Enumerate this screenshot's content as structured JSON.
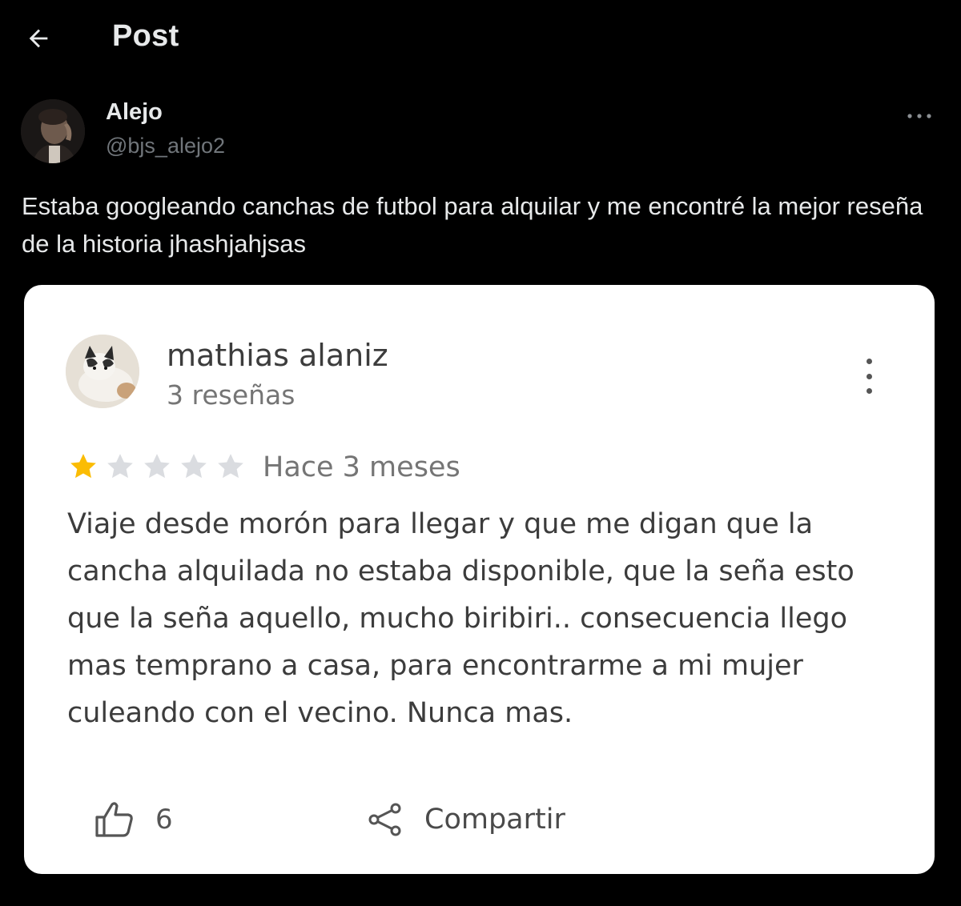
{
  "header": {
    "title": "Post"
  },
  "post": {
    "author_name": "Alejo",
    "author_handle": "@bjs_alejo2",
    "text": "Estaba googleando canchas de futbol para alquilar y me encontré la mejor reseña de la historia jhashjahjsas"
  },
  "review": {
    "reviewer_name": "mathias alaniz",
    "reviewer_count": "3 reseñas",
    "rating": 1,
    "rating_max": 5,
    "date": "Hace 3 meses",
    "text": "Viaje desde morón para llegar y que me digan que la cancha alquilada no estaba disponible, que la seña esto que la seña aquello, mucho biribiri.. consecuencia llego mas temprano a casa, para encontrarme a mi mujer culeando con el vecino. Nunca mas.",
    "likes": "6",
    "share_label": "Compartir"
  },
  "colors": {
    "background": "#000000",
    "card": "#ffffff",
    "star_filled": "#fbbc04",
    "star_empty": "#dadce0"
  },
  "icons": {
    "back": "arrow-left-icon",
    "more": "more-horizontal-icon",
    "kebab": "more-vertical-icon",
    "like": "thumbs-up-icon",
    "share": "share-icon",
    "star": "star-icon"
  }
}
